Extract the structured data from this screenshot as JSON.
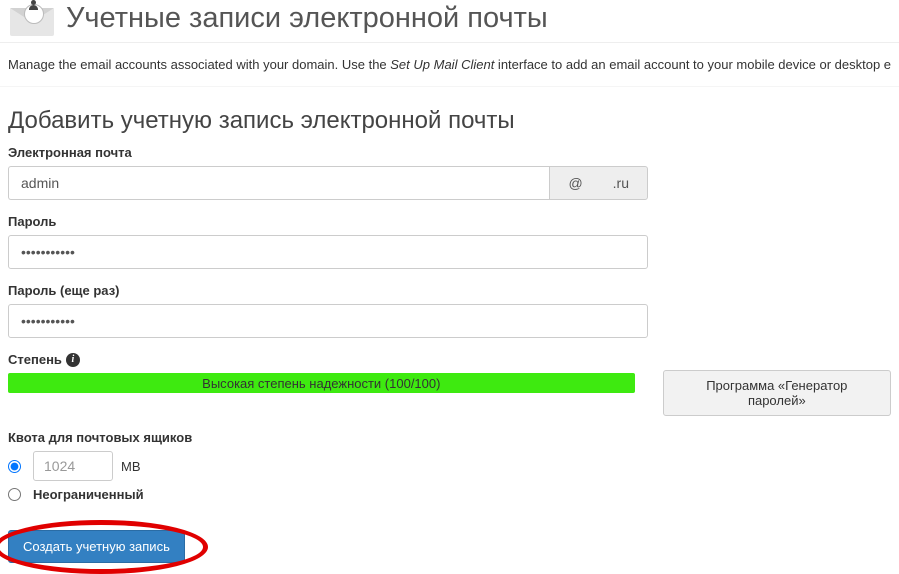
{
  "header": {
    "title": "Учетные записи электронной почты"
  },
  "description": {
    "prefix": "Manage the email accounts associated with your domain. Use the ",
    "emphasized": "Set Up Mail Client",
    "suffix": " interface to add an email account to your mobile device or desktop e"
  },
  "form": {
    "section_title": "Добавить учетную запись электронной почты",
    "email": {
      "label": "Электронная почта",
      "value": "admin",
      "at": "@",
      "domain": ".ru"
    },
    "password": {
      "label": "Пароль",
      "value": "•••••••••••"
    },
    "password_repeat": {
      "label": "Пароль (еще раз)",
      "value": "•••••••••••"
    },
    "strength": {
      "label": "Степень",
      "text": "Высокая степень надежности (100/100)"
    },
    "generator_button": "Программа «Генератор паролей»",
    "quota": {
      "label": "Квота для почтовых ящиков",
      "value": "1024",
      "unit": "MB",
      "unlimited_label": "Неограниченный"
    },
    "create_button": "Создать учетную запись"
  }
}
